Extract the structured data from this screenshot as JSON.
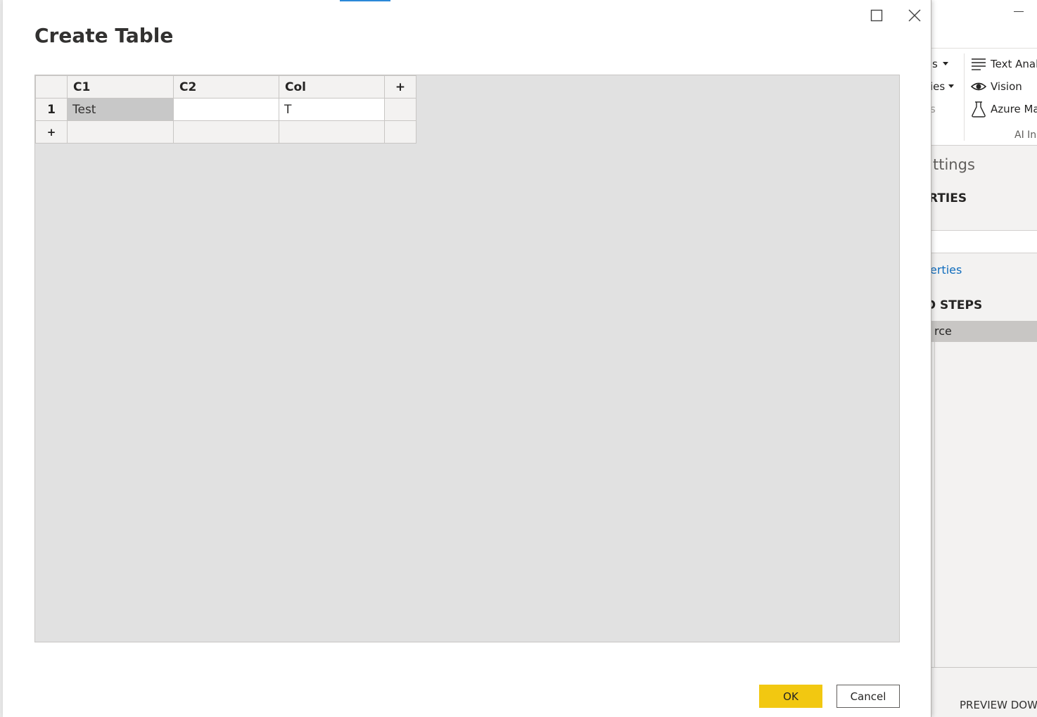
{
  "background_app": {
    "ribbon_fragments": [
      "s",
      "ies",
      "s"
    ],
    "ribbon_items": [
      {
        "label": "Text Analy",
        "icon": "text-lines-icon"
      },
      {
        "label": "Vision",
        "icon": "eye-icon"
      },
      {
        "label": "Azure Ma",
        "icon": "flask-icon"
      }
    ],
    "ribbon_group_label": "AI In",
    "settings_title": "ttings",
    "properties_header": "RTIES",
    "properties_link": "erties",
    "applied_steps_header": "D STEPS",
    "applied_steps": [
      "rce"
    ],
    "status_text": "PREVIEW DOW"
  },
  "dialog": {
    "title": "Create Table",
    "columns": [
      "C1",
      "C2",
      "Col"
    ],
    "add_column_label": "+",
    "rows": [
      {
        "row_number": "1",
        "cells": [
          "Test",
          "",
          "T"
        ]
      }
    ],
    "add_row_label": "+",
    "ok_label": "OK",
    "cancel_label": "Cancel"
  },
  "colors": {
    "accent_yellow": "#f2c811",
    "tab_accent_blue": "#2b88d8",
    "link_blue": "#0f6cbd",
    "grid_background": "#e1e1e1"
  }
}
